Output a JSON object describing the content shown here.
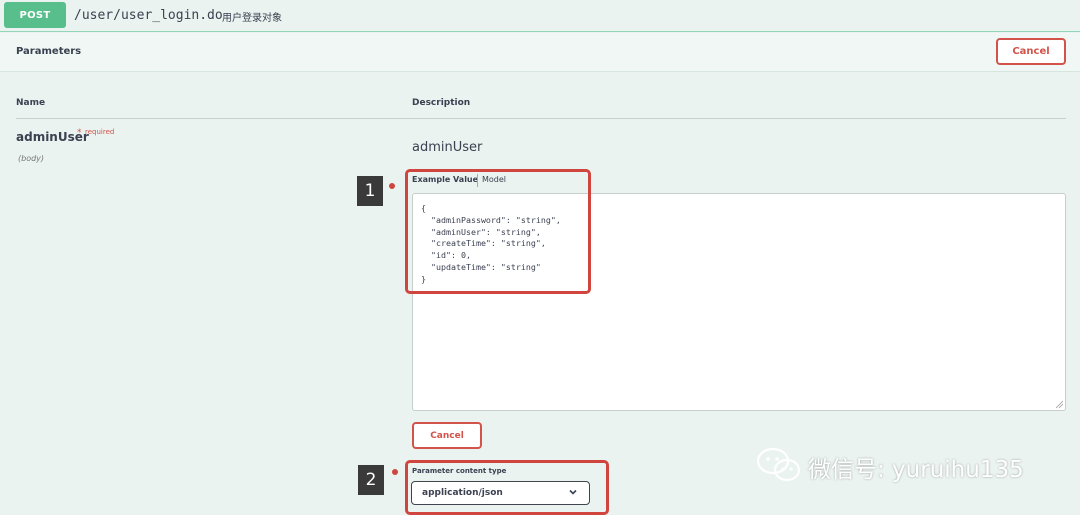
{
  "operation": {
    "method": "POST",
    "path": "/user/user_login.do",
    "summary": "用户登录对象"
  },
  "parameters": {
    "title": "Parameters",
    "cancel_label": "Cancel",
    "columns": {
      "name": "Name",
      "description": "Description"
    },
    "items": [
      {
        "name": "adminUser",
        "required_star": "*",
        "required_label": "required",
        "in": "(body)",
        "description": "adminUser"
      }
    ]
  },
  "example": {
    "tab_example": "Example Value",
    "tab_model": "Model",
    "body_value": "{\n  \"adminPassword\": \"string\",\n  \"adminUser\": \"string\",\n  \"createTime\": \"string\",\n  \"id\": 0,\n  \"updateTime\": \"string\"\n}",
    "cancel_label": "Cancel"
  },
  "content_type": {
    "label": "Parameter content type",
    "selected": "application/json"
  },
  "annotations": {
    "callout_1": "1",
    "callout_2": "2",
    "color": "#d0463f"
  },
  "watermark": {
    "text": "微信号: yuruihu135",
    "icon": "wechat-icon"
  },
  "colors": {
    "post_green": "#58be8b",
    "cancel_red": "#d2534a",
    "background": "#eaf3ef"
  }
}
